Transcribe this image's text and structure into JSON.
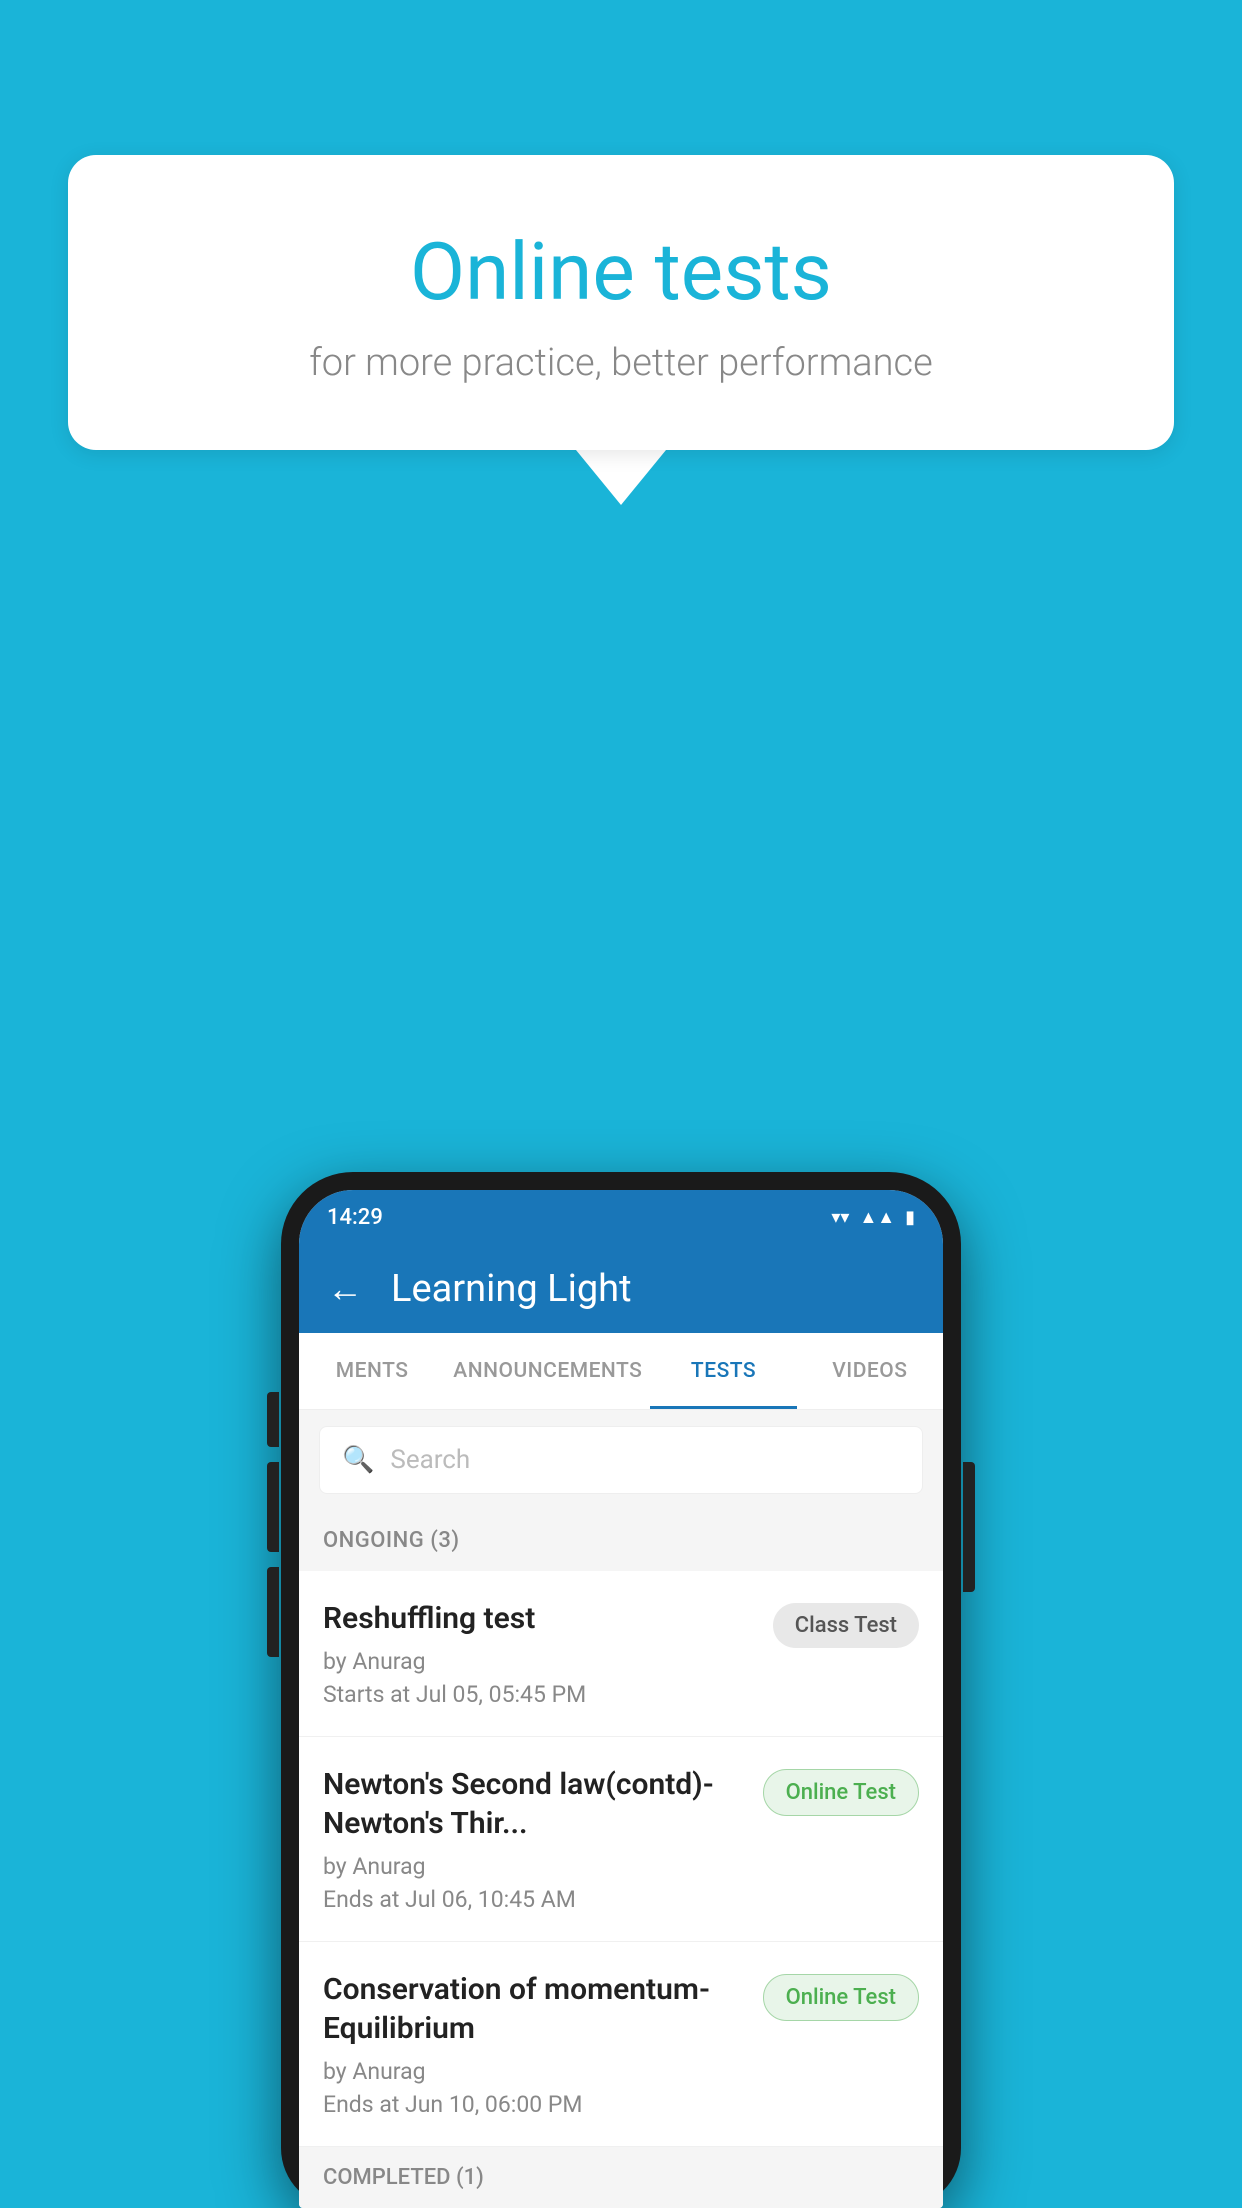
{
  "background_color": "#1ab4d8",
  "speech_bubble": {
    "title": "Online tests",
    "subtitle": "for more practice, better performance"
  },
  "phone": {
    "status_bar": {
      "time": "14:29",
      "icons": [
        "wifi",
        "signal",
        "battery"
      ]
    },
    "app_bar": {
      "title": "Learning Light",
      "back_label": "←"
    },
    "tabs": [
      {
        "label": "MENTS",
        "active": false
      },
      {
        "label": "ANNOUNCEMENTS",
        "active": false
      },
      {
        "label": "TESTS",
        "active": true
      },
      {
        "label": "VIDEOS",
        "active": false
      }
    ],
    "search": {
      "placeholder": "Search"
    },
    "sections": [
      {
        "header": "ONGOING (3)",
        "items": [
          {
            "title": "Reshuffling test",
            "by": "by Anurag",
            "time": "Starts at  Jul 05, 05:45 PM",
            "badge": "Class Test",
            "badge_type": "class"
          },
          {
            "title": "Newton's Second law(contd)-Newton's Thir...",
            "by": "by Anurag",
            "time": "Ends at  Jul 06, 10:45 AM",
            "badge": "Online Test",
            "badge_type": "online"
          },
          {
            "title": "Conservation of momentum-Equilibrium",
            "by": "by Anurag",
            "time": "Ends at  Jun 10, 06:00 PM",
            "badge": "Online Test",
            "badge_type": "online"
          }
        ]
      },
      {
        "header": "COMPLETED (1)",
        "items": []
      }
    ]
  }
}
